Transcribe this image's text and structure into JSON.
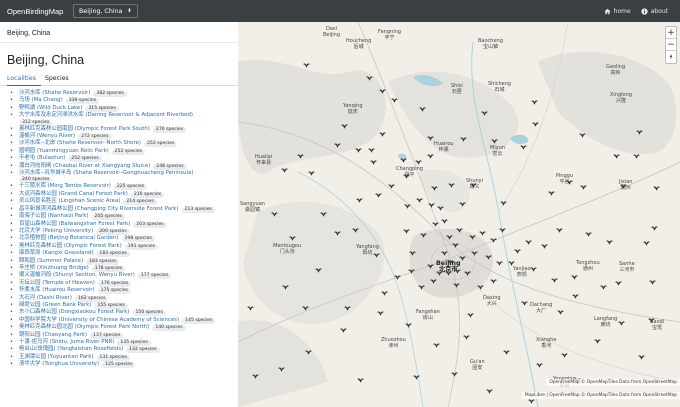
{
  "app": {
    "title": "OpenBirdingMap"
  },
  "nav": {
    "region": "Beijing, China",
    "home_label": "home",
    "about_label": "about"
  },
  "sidebar": {
    "header": "Beijing, China",
    "title": "Beijing, China",
    "tabs": [
      "Localities",
      "Species"
    ],
    "localities": [
      {
        "name": "沙河水库 (Shahe Reservoir)",
        "count": "382 species"
      },
      {
        "name": "马场 (Ma Chang)",
        "count": "339 species"
      },
      {
        "name": "野鸭湖 (Wild Duck Lake)",
        "count": "315 species"
      },
      {
        "name": "大宁水库及永定河滞洪水库 (Daning Reservoir & Adjacent Riverbed)",
        "count": "312 species"
      },
      {
        "name": "奥林匹克森林公园南园 (Olympic Forest Park South)",
        "count": "276 species"
      },
      {
        "name": "温榆河 (Wenyu River)",
        "count": "272 species"
      },
      {
        "name": "沙河水库--北岸 (Shahe Reservoir--North Shore)",
        "count": "252 species"
      },
      {
        "name": "圆明园 (Yuanmingyuan Relic Park)",
        "count": "252 species"
      },
      {
        "name": "不老屯 (Bulaotun)",
        "count": "252 species"
      },
      {
        "name": "潮白河向阳闸 (Chaobai River at Xiangyang Sluice)",
        "count": "248 species"
      },
      {
        "name": "沙河水库--巩华城半岛 (Shahe Reservoir--Gonghuacheng Peninsula)",
        "count": "240 species"
      },
      {
        "name": "十三陵水库 (Ming Tombs Reservoir)",
        "count": "225 species"
      },
      {
        "name": "大运河森林公园 (Grand Canal Forest Park)",
        "count": "216 species"
      },
      {
        "name": "灵山风景名胜区 (Lingshan Scenic Area)",
        "count": "214 species"
      },
      {
        "name": "昌平新城滨河森林公园 (Changping City Riverside Forest Park)",
        "count": "213 species"
      },
      {
        "name": "南海子公园 (Nanhaizi Park)",
        "count": "205 species"
      },
      {
        "name": "百望山森林公园 (Baiwangshan Forest Park)",
        "count": "203 species"
      },
      {
        "name": "北京大学 (Peking University)",
        "count": "200 species"
      },
      {
        "name": "北京植物园 (Beijing Botanical Garden)",
        "count": "198 species"
      },
      {
        "name": "奥林匹克森林公园 (Olympic Forest Park)",
        "count": "191 species"
      },
      {
        "name": "康西草原 (Kangxi Grassland)",
        "count": "183 species"
      },
      {
        "name": "颐和园 (Summer Palace)",
        "count": "183 species"
      },
      {
        "name": "辛庄桥 (Xinzhuang Bridge)",
        "count": "178 species"
      },
      {
        "name": "顺义温榆河段 (Shunyi Section, Wenyu River)",
        "count": "177 species"
      },
      {
        "name": "天坛公园 (Temple of Heaven)",
        "count": "176 species"
      },
      {
        "name": "怀柔水库 (Huairou Reservoir)",
        "count": "175 species"
      },
      {
        "name": "大石河 (Dashi River)",
        "count": "162 species"
      },
      {
        "name": "绿堤公园 (Green Bank Park)",
        "count": "155 species"
      },
      {
        "name": "东小口森林公园 (Dongxiaokou Forest Park)",
        "count": "150 species"
      },
      {
        "name": "中国科学院大学 (University of Chinese Academy of Sciences)",
        "count": "145 species"
      },
      {
        "name": "奥林匹克森林公园北园 (Olympic Forest Park North)",
        "count": "140 species"
      },
      {
        "name": "朝阳公园 (Chaoyang Park)",
        "count": "137 species"
      },
      {
        "name": "十渡-拒马河 (Shidu, Juma River PNR)",
        "count": "135 species"
      },
      {
        "name": "杨台山(玫瑰园) (Yangtaishan Rosefields)",
        "count": "132 species"
      },
      {
        "name": "玉渊潭公园 (Yuyuantan Park)",
        "count": "131 species"
      },
      {
        "name": "清华大学 (Tsinghua University)",
        "count": "125 species"
      }
    ]
  },
  "map": {
    "zoom_in": "+",
    "zoom_out": "−",
    "attribution_top": "OpenFreeMap © OpenMapTiles Data from OpenStreetMap",
    "attribution_bottom": "MapLibre | OpenFreeMap © OpenMapTiles Data from OpenStreetMap",
    "places": [
      {
        "name": "Dasi\nBeijing",
        "cls": ""
      },
      {
        "name": "Fengning\n丰宁",
        "cls": ""
      },
      {
        "name": "Houcheng\n后城",
        "cls": ""
      },
      {
        "name": "Baocheng\n宝山镇",
        "cls": ""
      },
      {
        "name": "Gaoling\n高岭",
        "cls": ""
      },
      {
        "name": "Yanqing\n延庆",
        "cls": ""
      },
      {
        "name": "Shisi\n石匣",
        "cls": ""
      },
      {
        "name": "Shicheng\n石城",
        "cls": ""
      },
      {
        "name": "Xinglong\n兴隆",
        "cls": ""
      },
      {
        "name": "Huailai\n怀来县",
        "cls": ""
      },
      {
        "name": "Miyun\n密云",
        "cls": ""
      },
      {
        "name": "Huairou\n怀柔",
        "cls": ""
      },
      {
        "name": "Sangyuan\n桑园镇",
        "cls": ""
      },
      {
        "name": "Changping\n昌平",
        "cls": ""
      },
      {
        "name": "Shunyi\n顺义",
        "cls": ""
      },
      {
        "name": "Pinggu\n平谷",
        "cls": ""
      },
      {
        "name": "Jixian\n蓟州",
        "cls": ""
      },
      {
        "name": "Mentougou\n门头沟",
        "cls": ""
      },
      {
        "name": "Beijing\n北京市",
        "cls": "big"
      },
      {
        "name": "Tongzhou\n通州",
        "cls": ""
      },
      {
        "name": "Yanjiao\n燕郊",
        "cls": ""
      },
      {
        "name": "Sanhe\n三河市",
        "cls": ""
      },
      {
        "name": "Yangfang\n阳坊",
        "cls": ""
      },
      {
        "name": "Daxing\n大兴",
        "cls": ""
      },
      {
        "name": "Dachang\n大厂",
        "cls": ""
      },
      {
        "name": "Fangshan\n房山",
        "cls": ""
      },
      {
        "name": "Xianghe\n香河",
        "cls": ""
      },
      {
        "name": "Zhuozhou\n涿州",
        "cls": ""
      },
      {
        "name": "Gu'an\n固安",
        "cls": ""
      },
      {
        "name": "Langfang\n廊坊",
        "cls": ""
      },
      {
        "name": "Baodi\n宝坻",
        "cls": ""
      },
      {
        "name": "Yongqing\n永清",
        "cls": ""
      }
    ]
  }
}
